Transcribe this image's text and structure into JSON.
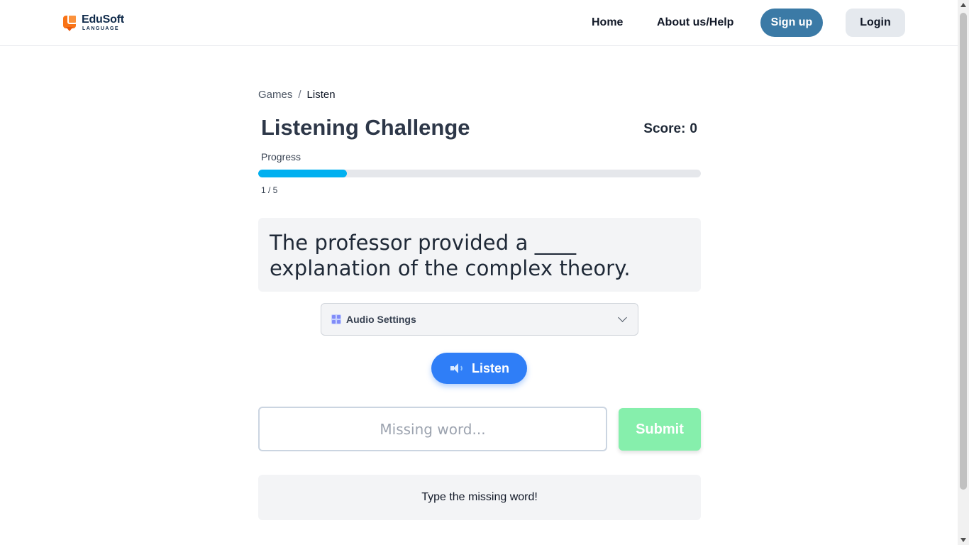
{
  "header": {
    "logo": {
      "name": "EduSoft",
      "sub": "LANGUAGE",
      "icon": "chat-bubble-logo-icon"
    },
    "nav": {
      "home": "Home",
      "about": "About us/Help",
      "signup": "Sign up",
      "login": "Login"
    }
  },
  "breadcrumb": {
    "parent": "Games",
    "separator": "/",
    "current": "Listen"
  },
  "game": {
    "title": "Listening Challenge",
    "score_label": "Score:",
    "score_value": "0",
    "progress_label": "Progress",
    "progress_fraction": 0.2,
    "progress_count": "1 / 5",
    "sentence": "The professor provided a ____ explanation of the complex theory.",
    "audio_settings_label": "Audio Settings",
    "listen_label": "Listen",
    "input_placeholder": "Missing word...",
    "submit_label": "Submit",
    "feedback": "Type the missing word!"
  },
  "colors": {
    "signup_bg": "#3b7aa6",
    "progress_fill": "#00b0f0",
    "listen_bg": "#2f7ef7",
    "submit_bg": "#86efac"
  }
}
